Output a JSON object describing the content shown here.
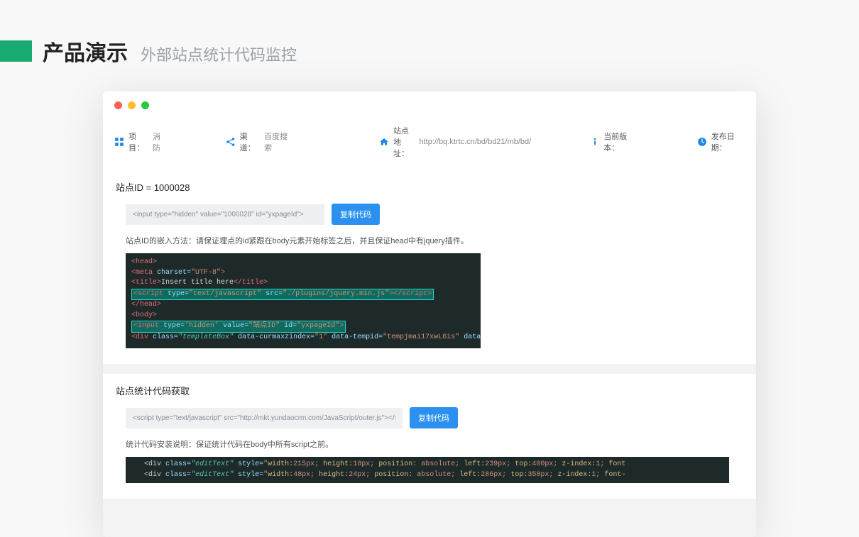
{
  "header": {
    "title": "产品演示",
    "subtitle": "外部站点统计代码监控"
  },
  "infobar": {
    "project_label": "项目：",
    "project_value": "消防",
    "channel_label": "渠道：",
    "channel_value": "百度搜索",
    "siteurl_label": "站点地址：",
    "siteurl_value": "http://bq.ktrtc.cn/bd/bd21/mb/bd/",
    "version_label": "当前版本：",
    "date_label": "发布日期："
  },
  "panel1": {
    "title": "站点ID = 1000028",
    "input_value": "<input type=\"hidden\" value=\"1000028\" id=\"yxpageId\">",
    "copy_btn": "复制代码",
    "instruction": "站点ID的嵌入方法：请保证埋点的id紧跟在body元素开始标签之后，并且保证head中有jquery插件。"
  },
  "panel2": {
    "title": "站点统计代码获取",
    "input_value": "<script type=\"text/javascript\" src=\"http://mkt.yundaocrm.com/JavaScript/outer.js\"></script>",
    "copy_btn": "复制代码",
    "instruction": "统计代码安装说明：保证统计代码在body中所有script之前。"
  }
}
